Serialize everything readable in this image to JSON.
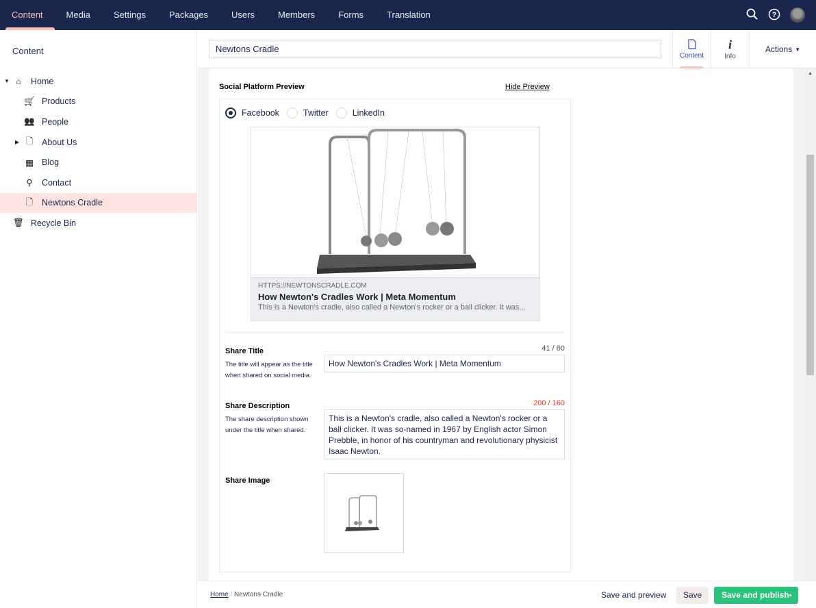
{
  "topnav": {
    "items": [
      "Content",
      "Media",
      "Settings",
      "Packages",
      "Users",
      "Members",
      "Forms",
      "Translation"
    ],
    "active": "Content",
    "icons": [
      "search-icon",
      "help-icon",
      "user-avatar"
    ]
  },
  "sidebar": {
    "title": "Content",
    "tree": [
      {
        "label": "Home",
        "icon": "home-icon",
        "level": 0,
        "caret": "down"
      },
      {
        "label": "Products",
        "icon": "cart-icon",
        "level": 1
      },
      {
        "label": "People",
        "icon": "people-icon",
        "level": 1
      },
      {
        "label": "About Us",
        "icon": "document-icon",
        "level": 1,
        "caret": "right"
      },
      {
        "label": "Blog",
        "icon": "calendar-icon",
        "level": 1
      },
      {
        "label": "Contact",
        "icon": "map-pin-icon",
        "level": 1
      },
      {
        "label": "Newtons Cradle",
        "icon": "document-icon",
        "level": 1,
        "selected": true
      },
      {
        "label": "Recycle Bin",
        "icon": "trash-icon",
        "level": 0
      }
    ]
  },
  "header": {
    "name": "Newtons Cradle",
    "apps": [
      {
        "label": "Content",
        "active": true
      },
      {
        "label": "Info"
      }
    ],
    "actions": "Actions"
  },
  "preview": {
    "title": "Social Platform Preview",
    "hide_link": "Hide Preview",
    "platforms": [
      "Facebook",
      "Twitter",
      "LinkedIn"
    ],
    "selected": "Facebook",
    "card": {
      "url": "HTTPS://NEWTONSCRADLE.COM",
      "title": "How Newton's Cradles Work | Meta Momentum",
      "description": "This is a Newton's cradle, also called a Newton's rocker or a ball clicker. It was..."
    }
  },
  "fields": {
    "share_title": {
      "label": "Share Title",
      "description": "The title will appear as the title when shared on social media.",
      "count": "41 / 60",
      "value": "How Newton's Cradles Work | Meta Momentum"
    },
    "share_description": {
      "label": "Share Description",
      "description": "The share description shown under the title when shared.",
      "count": "200 / 160",
      "value": "This is a Newton's cradle, also called a Newton's rocker or a ball clicker. It was so-named in 1967 by English actor Simon Prebble, in honor of his countryman and revolutionary physicist Isaac Newton."
    },
    "share_image": {
      "label": "Share Image"
    }
  },
  "footer": {
    "breadcrumb": [
      "Home",
      "Newtons Cradle"
    ],
    "save_preview": "Save and preview",
    "save": "Save",
    "save_publish": "Save and publish"
  },
  "colors": {
    "topbar": "#1b264f",
    "accent": "#f5c1bc",
    "publish": "#2bc37c",
    "over_limit": "#f02e28"
  }
}
